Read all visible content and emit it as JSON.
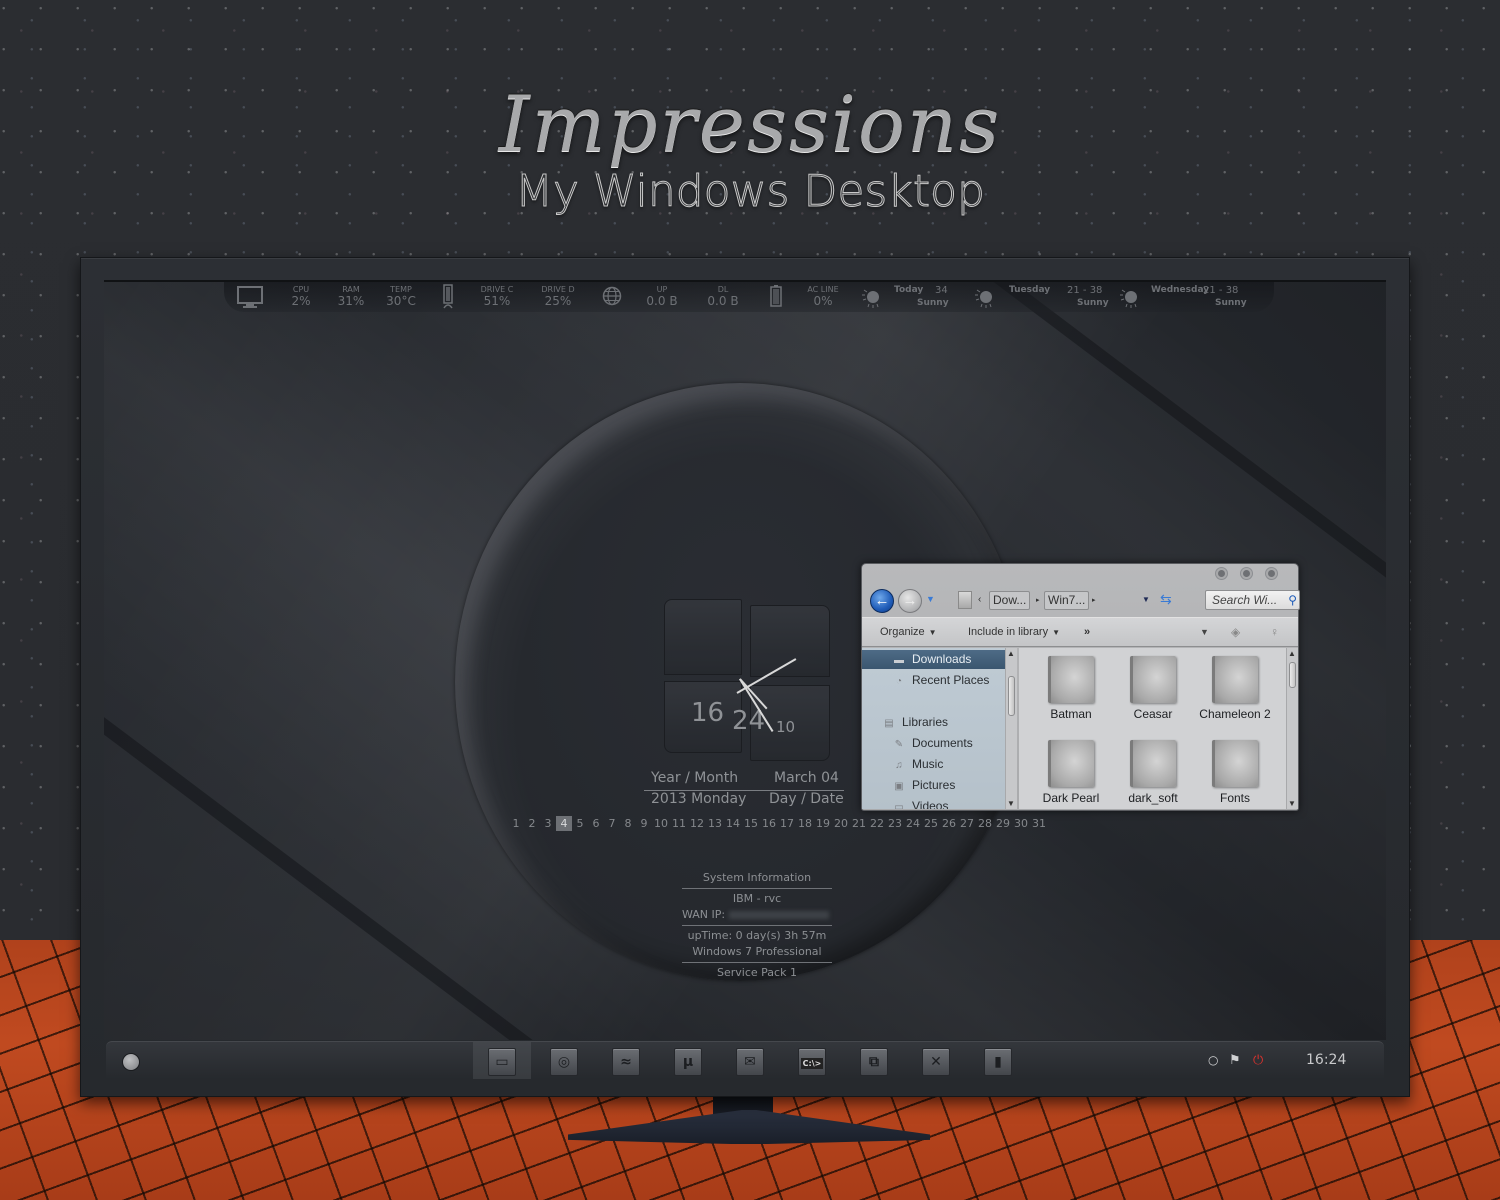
{
  "poster": {
    "title": "Impressions",
    "subtitle": "My Windows Desktop"
  },
  "stats_bar": {
    "stats": [
      {
        "label": "CPU",
        "value": "2%"
      },
      {
        "label": "RAM",
        "value": "31%"
      },
      {
        "label": "TEMP",
        "value": "30°C"
      },
      {
        "label": "DRIVE C",
        "value": "51%"
      },
      {
        "label": "DRIVE D",
        "value": "25%"
      },
      {
        "label": "UP",
        "value": "0.0 B"
      },
      {
        "label": "DL",
        "value": "0.0 B"
      },
      {
        "label": "AC LINE",
        "value": "0%"
      }
    ],
    "icons": {
      "monitor": "monitor-icon",
      "drive": "drive-icon",
      "network": "globe-icon",
      "battery": "battery-icon"
    },
    "weather": [
      {
        "day": "Today",
        "temp": "34",
        "condition": "Sunny"
      },
      {
        "day": "Tuesday",
        "temp": "21 -  38",
        "condition": "Sunny"
      },
      {
        "day": "Wednesday",
        "temp": "21 -  38",
        "condition": "Sunny"
      }
    ]
  },
  "clock": {
    "hours": "16",
    "minutes": "24",
    "seconds": "10",
    "year_month_label": "Year / Month",
    "month_day": "March 04",
    "year_weekday": "2013 Monday",
    "day_date_label": "Day / Date"
  },
  "calendar": {
    "days": [
      "1",
      "2",
      "3",
      "4",
      "5",
      "6",
      "7",
      "8",
      "9",
      "10",
      "11",
      "12",
      "13",
      "14",
      "15",
      "16",
      "17",
      "18",
      "19",
      "20",
      "21",
      "22",
      "23",
      "24",
      "25",
      "26",
      "27",
      "28",
      "29",
      "30",
      "31"
    ],
    "today": "4"
  },
  "system_info": {
    "title": "System Information",
    "computer": "IBM - rvc",
    "wan_ip_label": "WAN IP:",
    "uptime": "upTime: 0 day(s) 3h 57m",
    "os": "Windows 7 Professional",
    "service_pack": "Service Pack 1"
  },
  "explorer": {
    "breadcrumbs": [
      "Dow...",
      "Win7..."
    ],
    "search_placeholder": "Search Wi...",
    "toolbar": {
      "organize": "Organize",
      "include_in_library": "Include in library",
      "more": "»"
    },
    "nav_items": [
      {
        "label": "Downloads",
        "icon": "downloads-folder-icon",
        "selected": true
      },
      {
        "label": "Recent Places",
        "icon": "recent-places-icon"
      },
      {
        "label": "Libraries",
        "icon": "libraries-icon"
      },
      {
        "label": "Documents",
        "icon": "documents-icon"
      },
      {
        "label": "Music",
        "icon": "music-icon"
      },
      {
        "label": "Pictures",
        "icon": "pictures-icon"
      },
      {
        "label": "Videos",
        "icon": "videos-icon"
      }
    ],
    "folders": [
      "Batman",
      "Ceasar",
      "Chameleon 2",
      "Dark Pearl",
      "dark_soft",
      "Fonts"
    ]
  },
  "taskbar": {
    "pinned": [
      {
        "name": "explorer",
        "icon": "folder-icon",
        "glyph": "▭"
      },
      {
        "name": "chrome",
        "icon": "chrome-icon",
        "glyph": "◎"
      },
      {
        "name": "firefox",
        "icon": "firefox-icon",
        "glyph": "≈"
      },
      {
        "name": "utorrent",
        "icon": "utorrent-icon",
        "glyph": "µ"
      },
      {
        "name": "mail",
        "icon": "mail-icon",
        "glyph": "✉"
      },
      {
        "name": "command-prompt",
        "icon": "cmd-icon",
        "glyph": "C:\\>"
      },
      {
        "name": "remote-desktop",
        "icon": "network-computers-icon",
        "glyph": "⧉"
      },
      {
        "name": "tools",
        "icon": "tools-icon",
        "glyph": "✕"
      },
      {
        "name": "notepad",
        "icon": "document-icon",
        "glyph": "▮"
      }
    ],
    "tray": {
      "clock": "16:24"
    }
  }
}
